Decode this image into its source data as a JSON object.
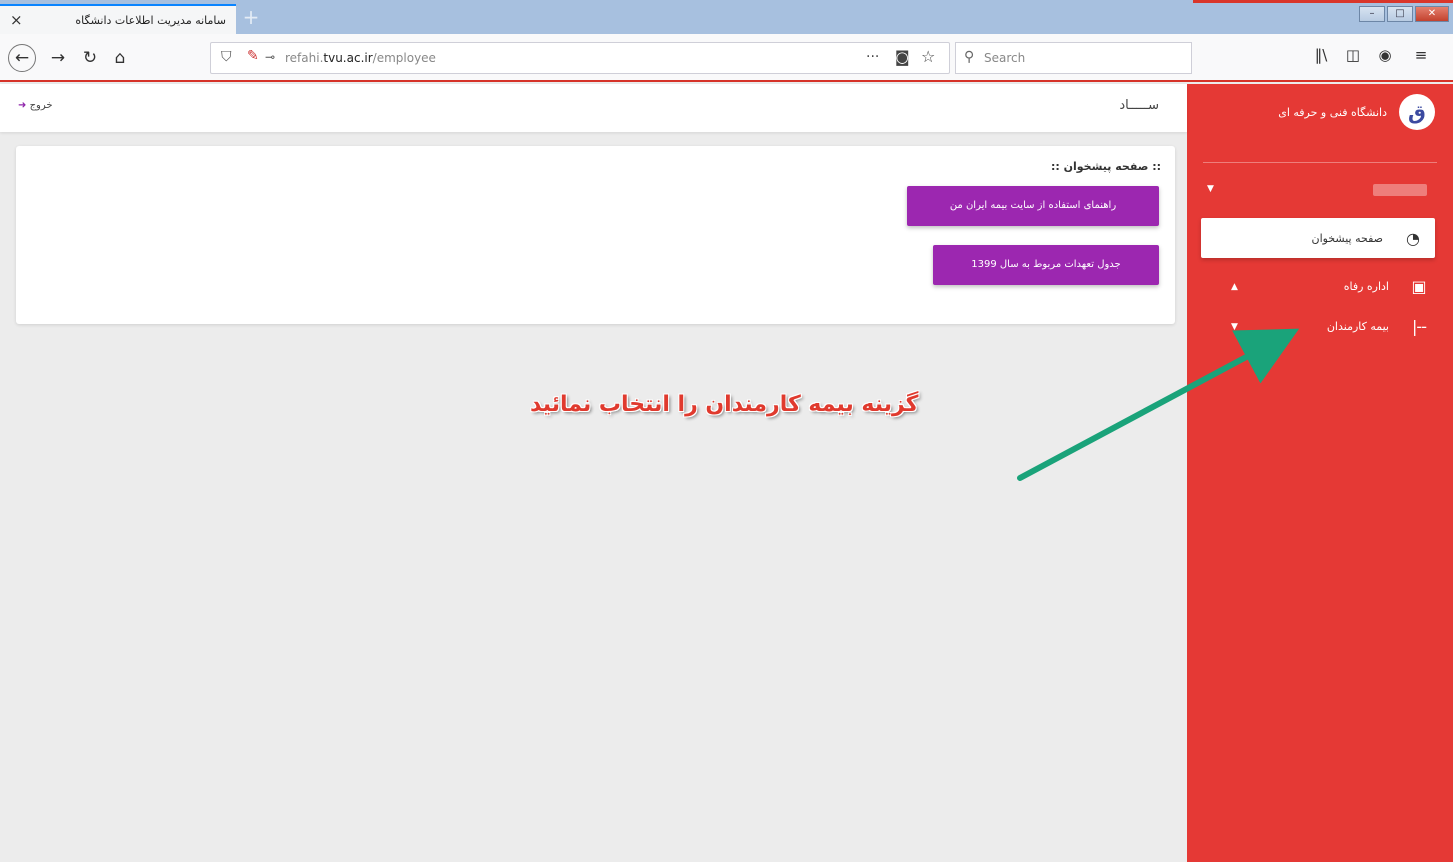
{
  "browser": {
    "tab_title": "سامانه مدیریت اطلاعات دانشگاه",
    "tab_close": "×",
    "new_tab": "+",
    "url_host": "refahi.",
    "url_domain": "tvu.ac.ir",
    "url_path": "/employee",
    "url_more": "···",
    "search_placeholder": "Search"
  },
  "app": {
    "title": "ســـــاد",
    "logout": "خروج",
    "brand_name": "دانشگاه فنی و حرفه ای",
    "brand_logo": "ق"
  },
  "sidebar": {
    "items": [
      {
        "label": "صفحه پیشخوان",
        "icon": "dashboard-icon",
        "active": true
      },
      {
        "label": "اداره رفاه",
        "icon": "briefcase-icon",
        "active": false
      },
      {
        "label": "بیمه کارمندان",
        "icon": "bracket-icon",
        "active": false
      }
    ]
  },
  "dashboard": {
    "title": ":: صفحه پیشخوان ::",
    "buttons": [
      {
        "label": "راهنمای استفاده از سایت بیمه ایران من"
      },
      {
        "label": "جدول تعهدات مربوط به سال 1399"
      }
    ]
  },
  "annotation": {
    "text": "گزینه بیمه کارمندان را انتخاب نمائید",
    "arrow_color": "#1aa37a",
    "text_color": "#e03a2e"
  },
  "colors": {
    "sidebar_red": "#e53935",
    "button_purple": "#9c27b0",
    "address_bar_accent": "#d63329"
  }
}
